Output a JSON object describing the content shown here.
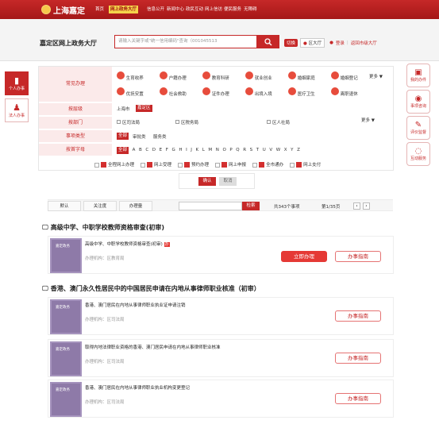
{
  "brand": {
    "logo_text": "上海嘉定"
  },
  "nav": [
    {
      "label": "首页"
    },
    {
      "label": "网上政务大厅"
    },
    {
      "label": "信息公开"
    },
    {
      "label": "新闻中心"
    },
    {
      "label": "政民互动"
    },
    {
      "label": "网上信访"
    },
    {
      "label": "便民服务"
    },
    {
      "label": "无障碍"
    }
  ],
  "header": {
    "hall_title": "嘉定区网上政务大厅",
    "search_placeholder": "请输入关键字或\"统一信用编码\"查询（001045513",
    "switch_label": "切换",
    "district": "区大厅",
    "login": "登录",
    "register": "返回市级大厅"
  },
  "left_tabs": [
    {
      "label": "个人办事"
    },
    {
      "label": "法人办事"
    }
  ],
  "right_tabs": [
    {
      "label": "我的办件"
    },
    {
      "label": "事项咨询"
    },
    {
      "label": "评价监督"
    },
    {
      "label": "互动服务"
    }
  ],
  "filter": {
    "common_topics_label": "常见办理",
    "topics": [
      {
        "label": "生育收养"
      },
      {
        "label": "户籍办理"
      },
      {
        "label": "教育科研"
      },
      {
        "label": "就业创业"
      },
      {
        "label": "婚姻家庭"
      },
      {
        "label": "婚姻登记"
      },
      {
        "label": "优抚安置"
      },
      {
        "label": "社会救助"
      },
      {
        "label": "证件办理"
      },
      {
        "label": "出境入境"
      },
      {
        "label": "医疗卫生"
      },
      {
        "label": "离职退休"
      }
    ],
    "more": "更多 ▼",
    "level_label": "按层级",
    "levels": [
      {
        "label": "上海市"
      },
      {
        "label": "嘉定区"
      }
    ],
    "dept_label": "按部门",
    "depts": [
      {
        "label": "区司法局"
      },
      {
        "label": "区税务局"
      },
      {
        "label": "区人社局"
      }
    ],
    "dept_more": "更多 ▼",
    "type_label": "事项类型",
    "types": [
      {
        "label": "全部"
      },
      {
        "label": "审批类"
      },
      {
        "label": "服务类"
      }
    ],
    "letter_label": "按首字母",
    "letters": [
      "全部",
      "A",
      "B",
      "C",
      "D",
      "E",
      "F",
      "G",
      "H",
      "I",
      "J",
      "K",
      "L",
      "M",
      "N",
      "O",
      "P",
      "Q",
      "R",
      "S",
      "T",
      "U",
      "V",
      "W",
      "X",
      "Y",
      "Z"
    ],
    "modes": [
      {
        "label": "全程网上办理"
      },
      {
        "label": "网上受理"
      },
      {
        "label": "预约办理"
      },
      {
        "label": "网上申报"
      },
      {
        "label": "全市通办"
      },
      {
        "label": "网上支付"
      }
    ],
    "confirm": "确认",
    "reset": "取消"
  },
  "listbar": {
    "tabs": [
      {
        "label": "默认"
      },
      {
        "label": "关注度"
      },
      {
        "label": "办理量"
      }
    ],
    "search_btn": "检索",
    "count": "共343个事项",
    "page": "第1/35页"
  },
  "sections": [
    {
      "title": "高级中学、中职学校教师资格审查(初审)",
      "items": [
        {
          "title": "高级中学、中职学校教师资格审查(初审)",
          "badge": "办",
          "org": "办理机构：区教育局",
          "apply": "立即办理",
          "guide": "办事指南"
        }
      ]
    },
    {
      "title": "香港、澳门永久性居民中的中国居民申请在内地从事律师职业核准（初审）",
      "items": [
        {
          "title": "香港、澳门居民在内地从事律师职业执业证申请注销",
          "org": "办理机构：区司法局",
          "guide": "办事指南"
        },
        {
          "title": "取得内地法律职业资格的香港、澳门居民申请在内地从事律师职业核准",
          "org": "办理机构：区司法局",
          "guide": "办事指南"
        },
        {
          "title": "香港、澳门居民在内地从事律师职业执业机构变更登记",
          "org": "办理机构：区司法局",
          "guide": "办事指南"
        }
      ]
    }
  ],
  "thumb_text": "嘉定政务",
  "colors": {
    "brand_red": "#c62828",
    "accent_gold": "#f4d34a",
    "thumb_purple": "#8e7aa8"
  }
}
